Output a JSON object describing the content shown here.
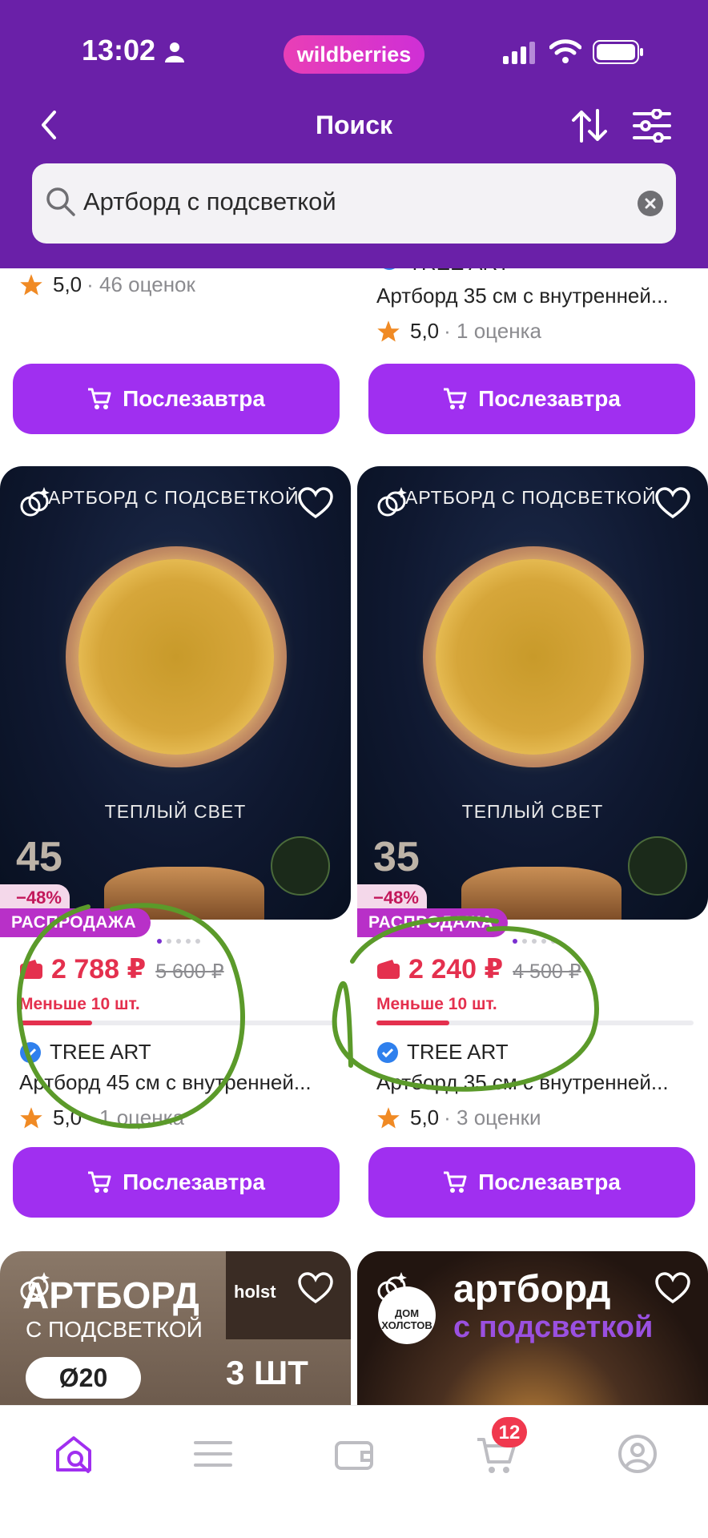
{
  "status": {
    "time": "13:02"
  },
  "brand_pill": "wildberries",
  "header": {
    "title": "Поиск"
  },
  "search": {
    "value": "Артборд с подсветкой"
  },
  "top_row": [
    {
      "rating": "5,0",
      "reviews": "· 46 оценок",
      "button": "Послезавтра"
    },
    {
      "brand": "TREE ART",
      "name": "Артборд 35 см с внутренней...",
      "rating": "5,0",
      "reviews": "· 1 оценка",
      "button": "Послезавтра"
    }
  ],
  "products": [
    {
      "photo_title": "АРТБОРД С ПОДСВЕТКОЙ",
      "photo_subtitle": "ТЕПЛЫЙ СВЕТ",
      "photo_size": "45",
      "discount": "−48%",
      "sale": "РАСПРОДАЖА",
      "price": "2 788 ₽",
      "old_price": "5 600 ₽",
      "stock": "Меньше 10 шт.",
      "stock_fill": 0.23,
      "brand": "TREE ART",
      "name": "Артборд 45 см с внутренней...",
      "rating": "5,0",
      "reviews": "· 1 оценка",
      "button": "Послезавтра"
    },
    {
      "photo_title": "АРТБОРД С ПОДСВЕТКОЙ",
      "photo_subtitle": "ТЕПЛЫЙ СВЕТ",
      "photo_size": "35",
      "discount": "−48%",
      "sale": "РАСПРОДАЖА",
      "price": "2 240 ₽",
      "old_price": "4 500 ₽",
      "stock": "Меньше 10 шт.",
      "stock_fill": 0.23,
      "brand": "TREE ART",
      "name": "Артборд 35 см с внутренней...",
      "rating": "5,0",
      "reviews": "· 3 оценки",
      "button": "Послезавтра"
    }
  ],
  "bottom_row": [
    {
      "title": "АРТБОРД",
      "subtitle": "С ПОДСВЕТКОЙ",
      "diameter": "Ø20",
      "quantity": "3 ШТ",
      "logo": "holst"
    },
    {
      "title": "артборд",
      "subtitle": "с подсветкой",
      "logo": "ДОМ ХОЛСТОВ"
    }
  ],
  "nav": {
    "cart_badge": "12"
  },
  "colors": {
    "header": "#6a20a8",
    "accent": "#a02ff0",
    "price": "#e4304e",
    "annotation": "#5b9a2a"
  }
}
